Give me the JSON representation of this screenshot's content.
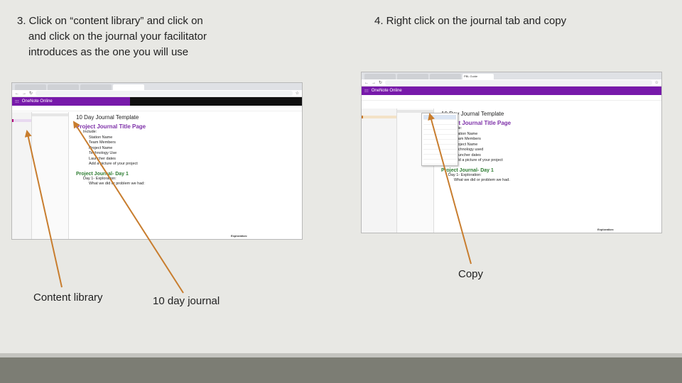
{
  "step3": {
    "line1": "3. Click on “content library” and click on",
    "line2": "and click on the journal your facilitator",
    "line3": "introduces as the one you will use"
  },
  "step4": {
    "text": "4. Right click on the journal tab and copy"
  },
  "captions": {
    "content_library": "Content library",
    "ten_day_journal": "10 day journal",
    "copy": "Copy"
  },
  "colors": {
    "arrow": "#c87d2e",
    "onenote_purple": "#7719aa",
    "footer": "#7c7d74"
  },
  "screenshot1": {
    "tabs": [
      "",
      "",
      "",
      ""
    ],
    "app_name": "OneNote Online",
    "page": {
      "title": "10 Day Journal Template",
      "heading1": "Project Journal Title Page",
      "include": "Include:",
      "items": [
        "Station Name",
        "Team Members",
        "Project Name",
        "Technology Use",
        "Launcher dates",
        "Add a picture of your project"
      ],
      "heading2": "Project Journal- Day 1",
      "day_line": "Day 1- Exploration:",
      "day_bullet": "What we did or problem we had:",
      "exploration": "Exploration:"
    }
  },
  "screenshot2": {
    "tabs": [
      "",
      "",
      "",
      "PBL Guide"
    ],
    "app_name": "OneNote Online",
    "page": {
      "title": "10 Day Journal Template",
      "heading1": "Project Journal Title Page",
      "include": "Include:",
      "items": [
        "Station Name",
        "Team Members",
        "Project Name",
        "Technology used",
        "Launcher dates",
        "Add a picture of your project"
      ],
      "heading2": "Project Journal- Day 1",
      "day_line": "Day 1- Exploration:",
      "day_bullet": "What we did or problem we had.",
      "exploration": "Exploration:"
    }
  }
}
